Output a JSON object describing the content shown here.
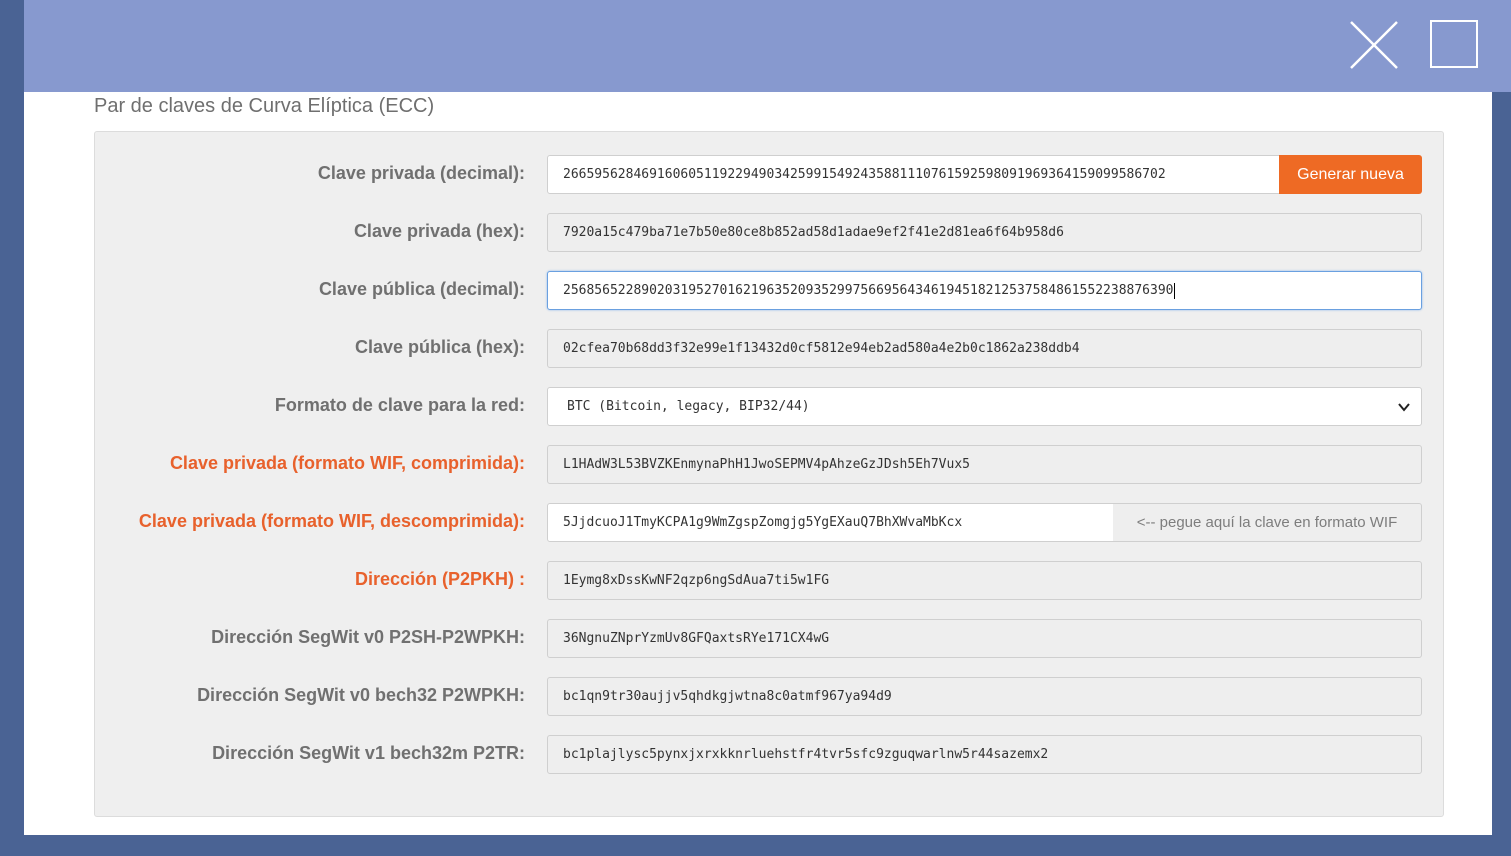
{
  "section_title": "Par de claves de Curva Elíptica (ECC)",
  "generate_button": "Generar nueva",
  "fields": {
    "private_decimal": {
      "label": "Clave privada (decimal):",
      "value": "26659562846916060511922949034259915492435881110761592598091969364159099586702"
    },
    "private_hex": {
      "label": "Clave privada (hex):",
      "value": "7920a15c479ba71e7b50e80ce8b852ad58d1adae9ef2f41e2d81ea6f64b958d6"
    },
    "public_decimal": {
      "label": "Clave pública (decimal):",
      "value": "2568565228902031952701621963520935299756695643461945182125375848615522388763​90"
    },
    "public_hex": {
      "label": "Clave pública (hex):",
      "value": "02cfea70b68dd3f32e99e1f13432d0cf5812e94eb2ad580a4e2b0c1862a238ddb4"
    },
    "network_format": {
      "label": "Formato de clave para la red:",
      "selected": "BTC (Bitcoin, legacy, BIP32/44)"
    },
    "wif_compressed": {
      "label": "Clave privada (formato WIF, comprimida):",
      "value": "L1HAdW3L53BVZKEnmynaPhH1JwoSEPMV4pAhzeGzJDsh5Eh7Vux5"
    },
    "wif_uncompressed": {
      "label": "Clave privada (formato WIF, descomprimida):",
      "value": "5JjdcuoJ1TmyKCPA1g9WmZgspZomgjg5YgEXauQ7BhXWvaMbKcx",
      "addon": "<-- pegue aquí la clave en formato WIF"
    },
    "address_p2pkh": {
      "label": "Dirección (P2PKH) :",
      "value": "1Eymg8xDssKwNF2qzp6ngSdAua7ti5w1FG"
    },
    "segwit_p2sh": {
      "label": "Dirección SegWit v0 P2SH-P2WPKH:",
      "value": "36NgnuZNprYzmUv8GFQaxtsRYe171CX4wG"
    },
    "segwit_bech32": {
      "label": "Dirección SegWit v0 bech32 P2WPKH:",
      "value": "bc1qn9tr30aujjv5qhdkgjwtna8c0atmf967ya94d9"
    },
    "segwit_bech32m": {
      "label": "Dirección SegWit v1 bech32m P2TR:",
      "value": "bc1plajlysc5pynxjxrxkknrluehstfr4tvr5sfc9zguqwarlnw5r44sazemx2"
    }
  },
  "colors": {
    "accent": "#ee6a24",
    "header": "#8799cf",
    "frame": "#4a6394"
  }
}
